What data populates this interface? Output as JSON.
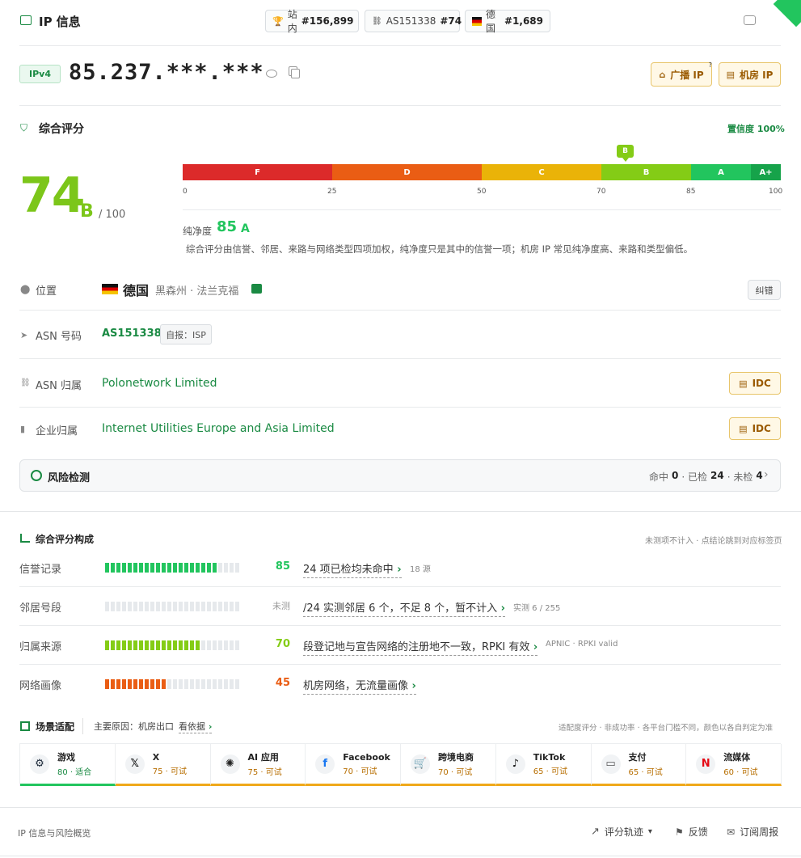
{
  "header": {
    "title": "IP 信息",
    "pills": [
      {
        "label": "站内",
        "value": "#156,899"
      },
      {
        "label": "AS151338",
        "value": "#74"
      },
      {
        "label": "德国",
        "value": "#1,689"
      }
    ]
  },
  "ip": {
    "version": "IPv4",
    "address": "85.237.***.***",
    "tags": [
      "广播 IP",
      "机房 IP"
    ],
    "tag_hint": "?"
  },
  "overall": {
    "title": "综合评分",
    "confidence": "置信度 100%",
    "score": "74",
    "grade": "B",
    "max": "/ 100",
    "purity_label": "纯净度",
    "purity_score": "85",
    "purity_grade": "A",
    "note": "综合评分由信誉、邻居、来路与网络类型四项加权，纯净度只是其中的信誉一项；机房 IP 常见纯净度高、来路和类型偏低。",
    "marker": "B"
  },
  "chart_data": {
    "type": "bar",
    "title": "",
    "categories": [
      "F",
      "D",
      "C",
      "B",
      "A",
      "A+"
    ],
    "ranges": [
      [
        0,
        25
      ],
      [
        25,
        50
      ],
      [
        50,
        70
      ],
      [
        70,
        85
      ],
      [
        85,
        97
      ],
      [
        97,
        100
      ]
    ],
    "ticks": [
      "0",
      "25",
      "50",
      "70",
      "85",
      "100"
    ],
    "current_value": 74,
    "colors": [
      "#dc2a2a",
      "#ea5d14",
      "#eab308",
      "#84cc16",
      "#22c55e",
      "#16a34a"
    ],
    "xlim": [
      0,
      100
    ]
  },
  "info": {
    "location": {
      "label": "位置",
      "country": "德国",
      "region": "黑森州 · 法兰克福",
      "action": "纠错"
    },
    "asn": {
      "label": "ASN 号码",
      "value": "AS151338",
      "badge": "自报：ISP"
    },
    "asn_owner": {
      "label": "ASN 归属",
      "value": "Polonetwork Limited",
      "tag": "IDC"
    },
    "org_owner": {
      "label": "企业归属",
      "value": "Internet Utilities Europe and Asia Limited",
      "tag": "IDC"
    }
  },
  "risk": {
    "title": "风险检测",
    "hit_label": "命中",
    "hit": "0",
    "checked_label": "· 已检",
    "checked": "24",
    "unchecked_label": "· 未检",
    "unchecked": "4"
  },
  "composition": {
    "title": "综合评分构成",
    "hint": "未测项不计入 · 点结论跳到对应标签页",
    "rows": [
      {
        "label": "信誉记录",
        "score": "85",
        "fraction": 0.85,
        "color": "#22c55e",
        "desc": "24 项已检均未命中",
        "sub": "18 源"
      },
      {
        "label": "邻居号段",
        "score": "未测",
        "fraction": 0,
        "color": "#22c55e",
        "desc": "/24 实测邻居 6 个，不足 8 个，暂不计入",
        "sub": "实测 6 / 255"
      },
      {
        "label": "归属来源",
        "score": "70",
        "fraction": 0.7,
        "color": "#84cc16",
        "desc": "段登记地与宣告网络的注册地不一致，RPKI 有效",
        "sub": "APNIC · RPKI valid"
      },
      {
        "label": "网络画像",
        "score": "45",
        "fraction": 0.45,
        "color": "#ea5d14",
        "desc": "机房网络，无流量画像",
        "sub": ""
      }
    ]
  },
  "scenes": {
    "title": "场景适配",
    "reason": "主要原因：机房出口",
    "link": "看依据",
    "hint": "适配度评分 · 非成功率 · 各平台门槛不同，颜色以各自判定为准",
    "cards": [
      {
        "name": "游戏",
        "score": "80 · 适合",
        "icon": "steam-icon"
      },
      {
        "name": "X",
        "score": "75 · 可试",
        "icon": "x-icon"
      },
      {
        "name": "AI 应用",
        "score": "75 · 可试",
        "icon": "openai-icon"
      },
      {
        "name": "Facebook",
        "score": "70 · 可试",
        "icon": "facebook-icon"
      },
      {
        "name": "跨境电商",
        "score": "70 · 可试",
        "icon": "cart-icon"
      },
      {
        "name": "TikTok",
        "score": "65 · 可试",
        "icon": "tiktok-icon"
      },
      {
        "name": "支付",
        "score": "65 · 可试",
        "icon": "card-icon"
      },
      {
        "name": "流媒体",
        "score": "60 · 可试",
        "icon": "netflix-icon"
      }
    ]
  },
  "footer": {
    "left": "IP 信息与风险概览",
    "trend": "评分轨迹",
    "feedback": "反馈",
    "subscribe": "订阅周报"
  }
}
